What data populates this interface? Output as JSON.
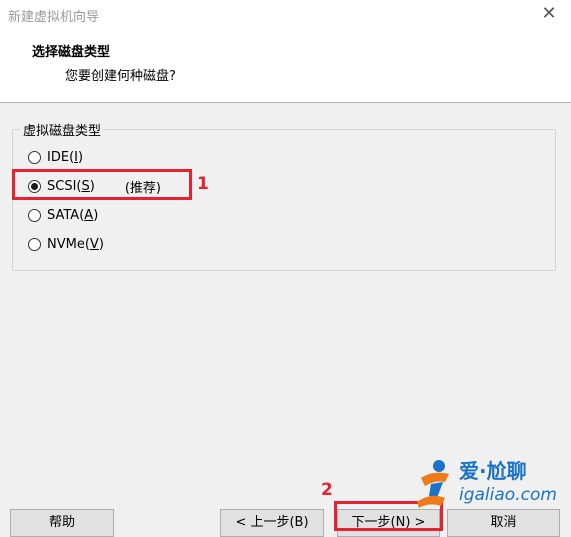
{
  "window": {
    "title": "新建虚拟机向导",
    "close_glyph": "✕"
  },
  "header": {
    "title": "选择磁盘类型",
    "subtitle": "您要创建何种磁盘?"
  },
  "disk_type_group": {
    "legend": "虚拟磁盘类型",
    "options": [
      {
        "name": "IDE",
        "mnemonic": "I",
        "checked": false
      },
      {
        "name": "SCSI",
        "mnemonic": "S",
        "checked": true,
        "note": "(推荐)"
      },
      {
        "name": "SATA",
        "mnemonic": "A",
        "checked": false
      },
      {
        "name": "NVMe",
        "mnemonic": "V",
        "checked": false
      }
    ]
  },
  "annotations": {
    "marker1": "1",
    "marker2": "2",
    "color": "#e8212e"
  },
  "buttons": {
    "help": "帮助",
    "back": "< 上一步(B)",
    "next": "下一步(N) >",
    "cancel": "取消"
  },
  "watermark": {
    "brand": "爱·尬聊",
    "url": "igaliao.com",
    "color": "#1a73c8"
  }
}
